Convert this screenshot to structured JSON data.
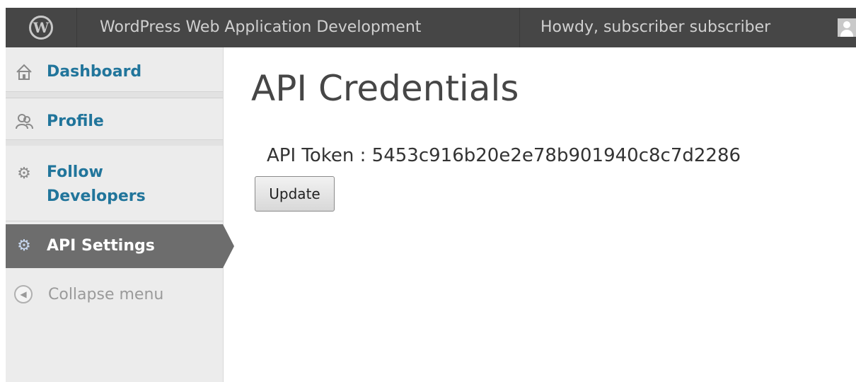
{
  "adminbar": {
    "logo_icon": "wordpress-logo-icon",
    "site_name": "WordPress Web Application Development",
    "howdy": "Howdy, subscriber subscriber",
    "avatar_icon": "avatar-icon"
  },
  "sidebar": {
    "items": [
      {
        "label": "Dashboard",
        "icon": "home-icon",
        "active": false
      },
      {
        "label": "Profile",
        "icon": "users-icon",
        "active": false
      },
      {
        "label": "Follow Developers",
        "icon": "gear-icon",
        "active": false
      },
      {
        "label": "API Settings",
        "icon": "gear-icon",
        "active": true
      }
    ],
    "collapse_label": "Collapse menu",
    "collapse_icon": "collapse-arrow-icon"
  },
  "main": {
    "title": "API Credentials",
    "token_label": "API Token : 5453c916b20e2e78b901940c8c7d2286",
    "update_button": "Update"
  },
  "colors": {
    "adminbar_bg": "#464646",
    "link": "#21759b",
    "active_menu_bg": "#6d6d6d",
    "sidebar_bg": "#ececec"
  }
}
